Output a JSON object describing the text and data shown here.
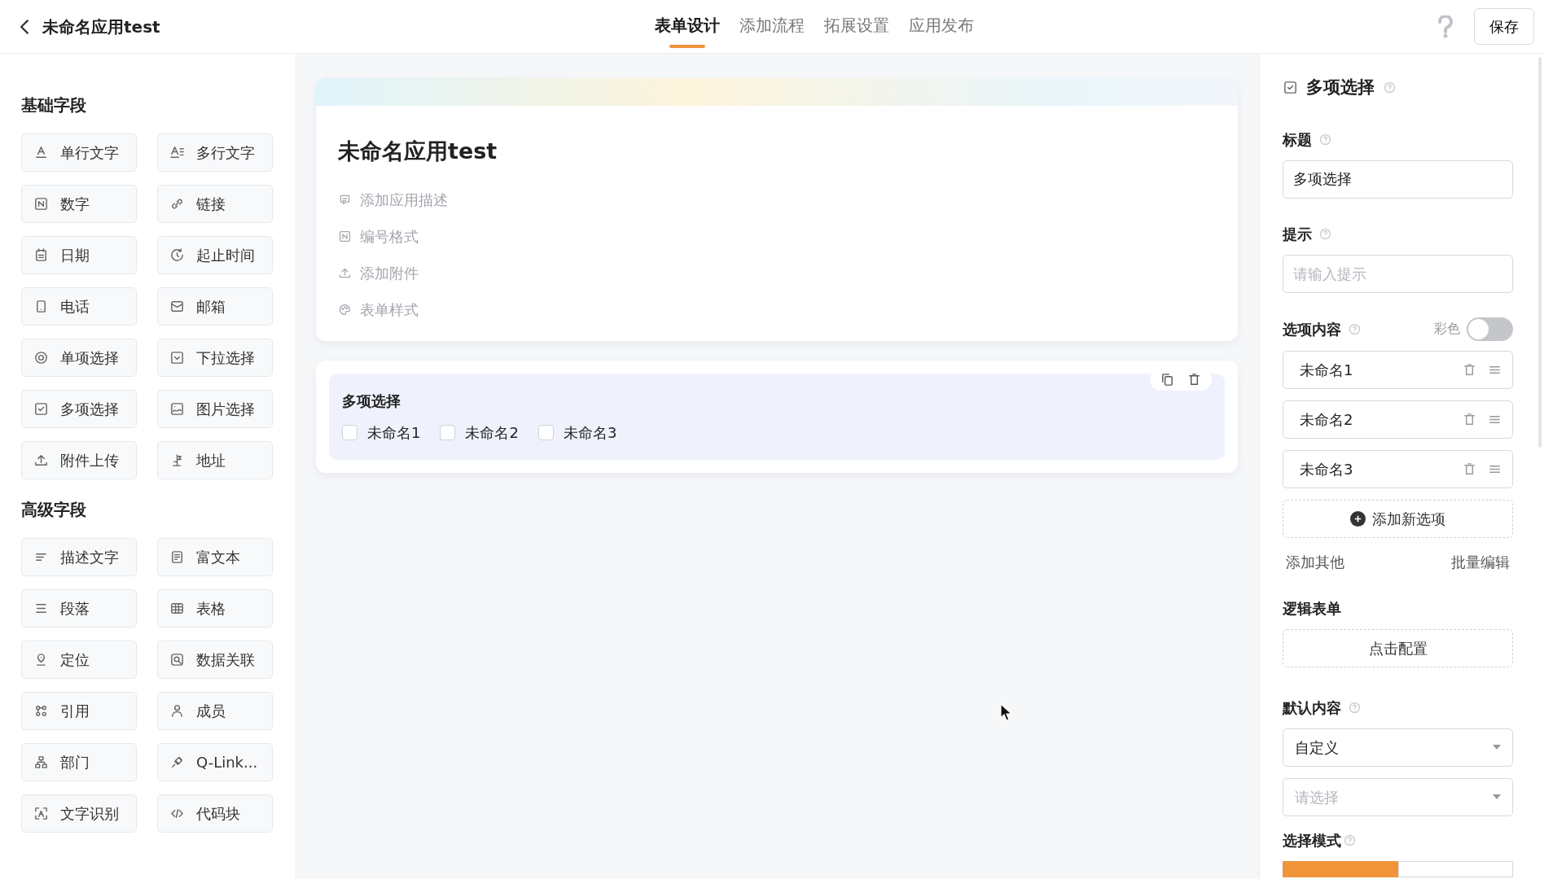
{
  "header": {
    "title": "未命名应用test",
    "tabs": [
      {
        "label": "表单设计",
        "selected": true
      },
      {
        "label": "添加流程",
        "selected": false
      },
      {
        "label": "拓展设置",
        "selected": false
      },
      {
        "label": "应用发布",
        "selected": false
      }
    ],
    "save_button": "保存"
  },
  "palette": {
    "sections": [
      {
        "title": "基础字段",
        "items": [
          "单行文字",
          "多行文字",
          "数字",
          "链接",
          "日期",
          "起止时间",
          "电话",
          "邮箱",
          "单项选择",
          "下拉选择",
          "多项选择",
          "图片选择",
          "附件上传",
          "地址"
        ]
      },
      {
        "title": "高级字段",
        "items": [
          "描述文字",
          "富文本",
          "段落",
          "表格",
          "定位",
          "数据关联",
          "引用",
          "成员",
          "部门",
          "Q-Link...",
          "文字识别",
          "代码块"
        ]
      }
    ]
  },
  "form": {
    "title": "未命名应用test",
    "actions": [
      "添加应用描述",
      "编号格式",
      "添加附件",
      "表单样式"
    ],
    "fields": [
      {
        "label": "多项选择",
        "selected": true,
        "options": [
          {
            "label": "未命名1",
            "checked": false
          },
          {
            "label": "未命名2",
            "checked": false
          },
          {
            "label": "未命名3",
            "checked": false
          }
        ]
      }
    ]
  },
  "properties": {
    "heading": "多项选择",
    "title_label": "标题",
    "title_value": "多项选择",
    "hint_label": "提示",
    "hint_placeholder": "请输入提示",
    "options_label": "选项内容",
    "color_label": "彩色",
    "color_on": false,
    "options": [
      "未命名1",
      "未命名2",
      "未命名3"
    ],
    "add_option": "添加新选项",
    "add_other": "添加其他",
    "bulk_edit": "批量编辑",
    "logic_label": "逻辑表单",
    "logic_button": "点击配置",
    "default_label": "默认内容",
    "default_value": "自定义",
    "default_placeholder": "请选择",
    "mode_label": "选择模式",
    "mode_segments": [
      {
        "selected": true
      },
      {
        "selected": false
      }
    ]
  }
}
